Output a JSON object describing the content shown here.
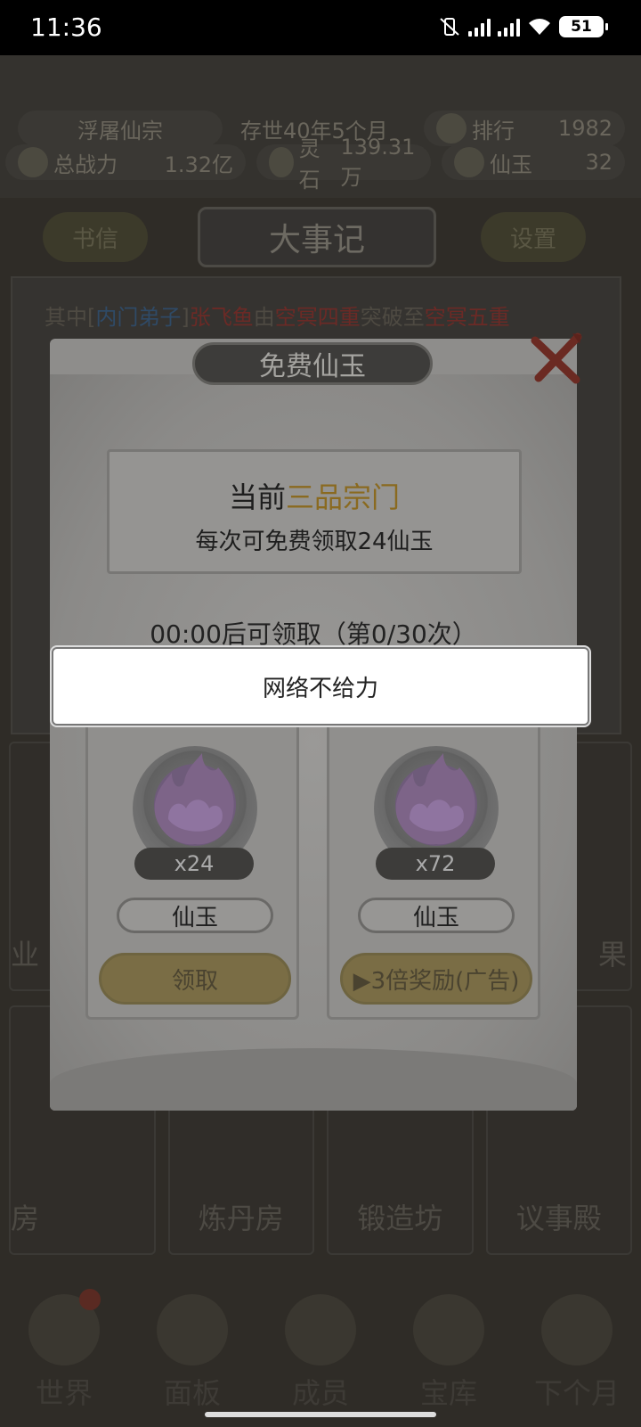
{
  "status_bar": {
    "time": "11:36",
    "battery": "51"
  },
  "game_header": {
    "sect_name": "浮屠仙宗",
    "existence": "存世40年5个月",
    "rank_label": "排行",
    "rank_value": "1982",
    "power_label": "总战力",
    "power_value": "1.32亿",
    "spirit_stone_label": "灵石",
    "spirit_stone_value": "139.31万",
    "jade_label": "仙玉",
    "jade_value": "32",
    "mail_button": "书信",
    "page_title": "大事记",
    "settings_button": "设置"
  },
  "log": {
    "prefix": "其中[",
    "rank": "内门弟子",
    "mid": "]",
    "name": "张飞鱼",
    "from_word": "由",
    "from_level": "空冥四重",
    "break_word": "突破至",
    "to_level": "空冥五重"
  },
  "buildings": {
    "row1": [
      "业",
      "",
      "果"
    ],
    "row2": [
      "房",
      "炼丹房",
      "锻造坊",
      "议事殿"
    ]
  },
  "bottom_nav": [
    "世界",
    "面板",
    "成员",
    "宝库",
    "下个月"
  ],
  "dialog": {
    "title": "免费仙玉",
    "current_prefix": "当前",
    "sect_grade": "三品宗门",
    "claim_info": "每次可免费领取24仙玉",
    "countdown": "00:00后可领取（第0/30次）",
    "rewards": [
      {
        "qty": "x24",
        "name": "仙玉",
        "button": "领取"
      },
      {
        "qty": "x72",
        "name": "仙玉",
        "button": "▶3倍奖励(广告)"
      }
    ]
  },
  "toast": {
    "message": "网络不给力"
  },
  "colors": {
    "highlight": "#e3a23a",
    "overlay": "#000000"
  }
}
